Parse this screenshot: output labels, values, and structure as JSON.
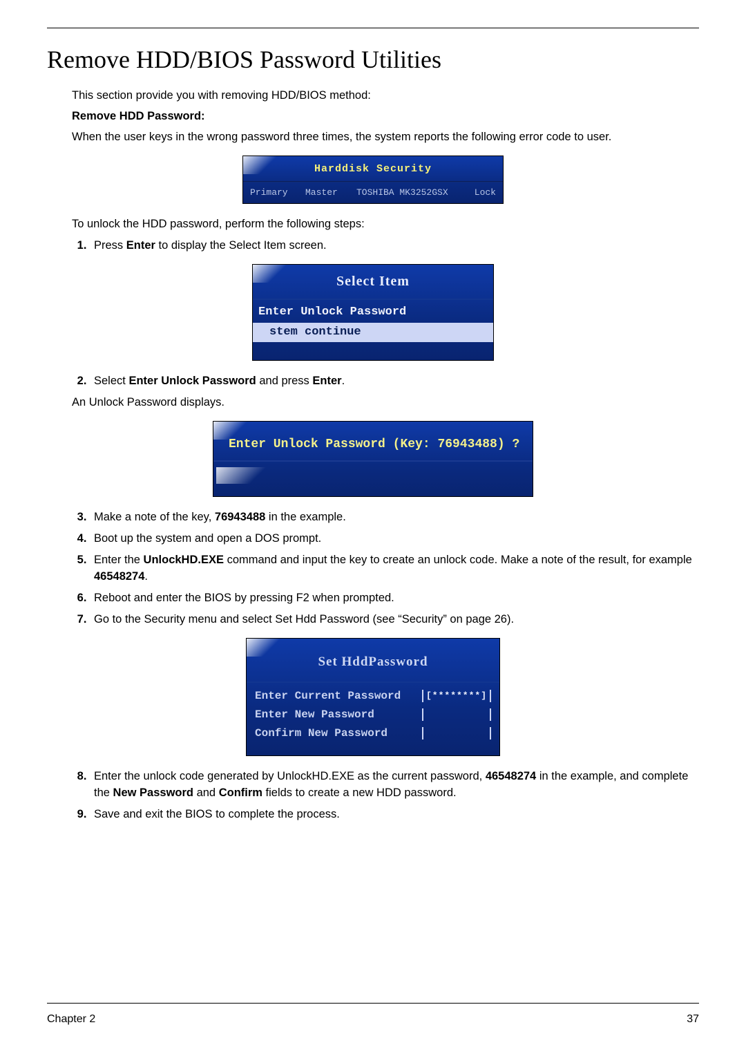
{
  "title": "Remove HDD/BIOS Password Utilities",
  "intro": "This section provide you with removing HDD/BIOS method:",
  "subhead": "Remove HDD Password:",
  "intro2": "When the user keys in the wrong password three times, the system reports the following error code to user.",
  "fig1": {
    "header": "Harddisk  Security",
    "c1": "Primary",
    "c2": "Master",
    "c3": "TOSHIBA MK3252GSX",
    "c4": "Lock"
  },
  "after_fig1": "To unlock the HDD password, perform the following steps:",
  "step1_pre": "Press ",
  "step1_b1": "Enter",
  "step1_post": " to display the Select Item screen.",
  "fig2": {
    "header": "Select Item",
    "opt1": "Enter Unlock Password",
    "opt2": "stem continue"
  },
  "step2_pre": "Select ",
  "step2_b1": "Enter Unlock Password",
  "step2_mid": " and press ",
  "step2_b2": "Enter",
  "step2_post": ".",
  "after_step2": "An Unlock Password displays.",
  "fig3": {
    "line": "Enter Unlock  Password (Key: 76943488) ?"
  },
  "step3_pre": "Make a note of the key, ",
  "step3_b1": "76943488",
  "step3_post": " in the example.",
  "step4": "Boot up the system and open a DOS prompt.",
  "step5_pre": "Enter the ",
  "step5_b1": "UnlockHD.EXE",
  "step5_mid": " command and input the key to create an unlock code. Make a note of the result, for example ",
  "step5_b2": "46548274",
  "step5_post": ".",
  "step6": "Reboot and enter the BIOS by pressing F2 when prompted.",
  "step7": "Go to the Security menu and select Set Hdd Password (see “Security” on page 26).",
  "fig4": {
    "header": "Set HddPassword",
    "r1": "Enter Current Password",
    "r1v": "[********]",
    "r2": "Enter New Password",
    "r2v": "[",
    "r2v2": "]",
    "r3": "Confirm New Password",
    "r3v": "[",
    "r3v2": "]"
  },
  "step8_pre": "Enter the unlock code generated by UnlockHD.EXE as the current password, ",
  "step8_b1": "46548274",
  "step8_mid": " in the example, and complete the ",
  "step8_b2": "New Password",
  "step8_mid2": " and ",
  "step8_b3": "Confirm",
  "step8_post": " fields to create a new HDD password.",
  "step9": "Save and exit the BIOS to complete the process.",
  "footer_left": "Chapter 2",
  "footer_right": "37"
}
